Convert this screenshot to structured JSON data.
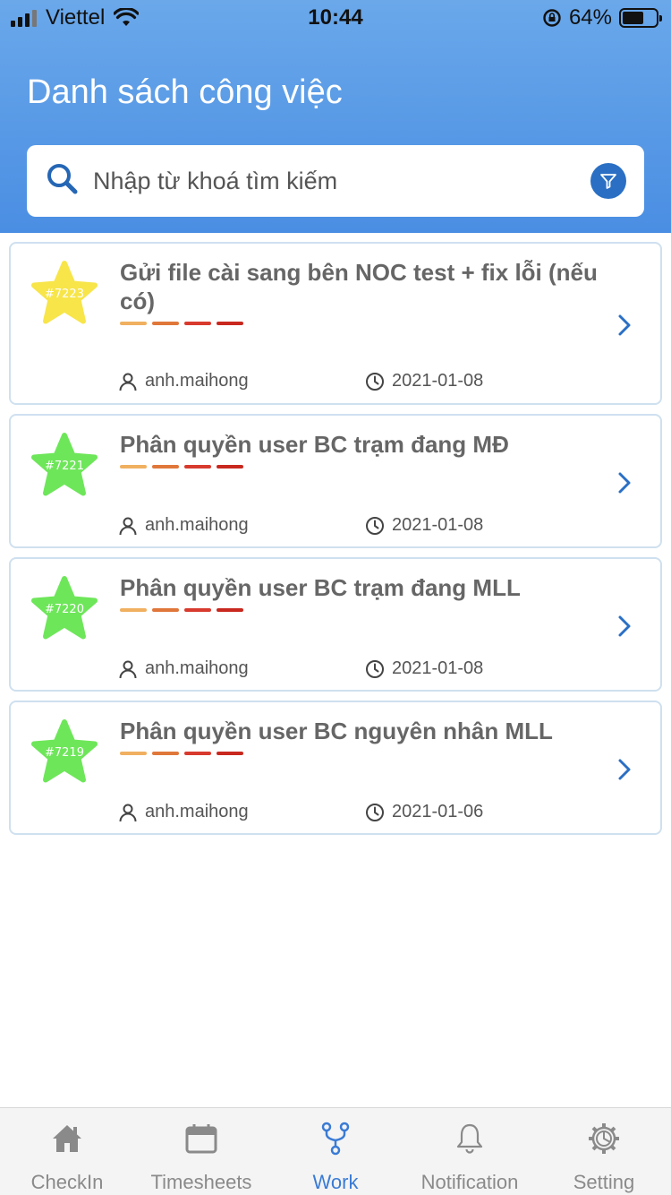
{
  "status_bar": {
    "carrier": "Viettel",
    "time": "10:44",
    "battery_percent": "64%",
    "battery_level": 0.64
  },
  "header": {
    "title": "Danh sách công việc"
  },
  "search": {
    "placeholder": "Nhập từ khoá tìm kiếm"
  },
  "colors": {
    "accent": "#3a7bd5",
    "star_yellow": "#f7e54a",
    "star_green": "#6ee65a",
    "priority": [
      "#f0b060",
      "#e0773a",
      "#d83a2e",
      "#c8281e"
    ]
  },
  "tasks": [
    {
      "id": "#7223",
      "title": "Gửi file cài sang bên NOC test + fix lỗi (nếu có)",
      "user": "anh.maihong",
      "date": "2021-01-08",
      "star_color": "yellow"
    },
    {
      "id": "#7221",
      "title": "Phân quyền user BC trạm đang MĐ",
      "user": "anh.maihong",
      "date": "2021-01-08",
      "star_color": "green"
    },
    {
      "id": "#7220",
      "title": "Phân quyền user BC trạm đang MLL",
      "user": "anh.maihong",
      "date": "2021-01-08",
      "star_color": "green"
    },
    {
      "id": "#7219",
      "title": "Phân quyền user BC nguyên nhân MLL",
      "user": "anh.maihong",
      "date": "2021-01-06",
      "star_color": "green"
    }
  ],
  "tabbar": {
    "tabs": [
      {
        "label": "CheckIn",
        "icon": "home-icon"
      },
      {
        "label": "Timesheets",
        "icon": "calendar-icon"
      },
      {
        "label": "Work",
        "icon": "branch-icon",
        "active": true
      },
      {
        "label": "Notification",
        "icon": "bell-icon"
      },
      {
        "label": "Setting",
        "icon": "gear-icon"
      }
    ]
  }
}
